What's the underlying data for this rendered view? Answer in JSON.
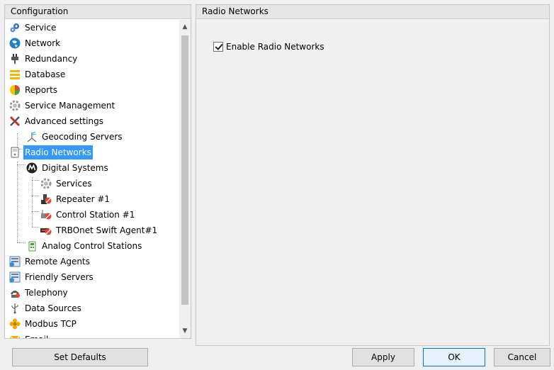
{
  "left_panel": {
    "header": "Configuration",
    "tree": [
      {
        "label": "Service",
        "icon": "gears-icon"
      },
      {
        "label": "Network",
        "icon": "network-globe-icon"
      },
      {
        "label": "Redundancy",
        "icon": "plug-icon"
      },
      {
        "label": "Database",
        "icon": "database-icon"
      },
      {
        "label": "Reports",
        "icon": "reports-icon"
      },
      {
        "label": "Service Management",
        "icon": "gear-icon"
      },
      {
        "label": "Advanced settings",
        "icon": "tools-icon"
      },
      {
        "label": "Geocoding Servers",
        "icon": "geocoding-icon"
      },
      {
        "label": "Radio Networks",
        "icon": "radio-icon",
        "selected": true
      },
      {
        "label": "Digital Systems",
        "icon": "motorola-icon"
      },
      {
        "label": "Services",
        "icon": "gear-icon"
      },
      {
        "label": "Repeater #1",
        "icon": "repeater-disabled-icon"
      },
      {
        "label": "Control Station #1",
        "icon": "control-station-disabled-icon"
      },
      {
        "label": "TRBOnet Swift Agent#1",
        "icon": "swift-agent-disabled-icon"
      },
      {
        "label": "Analog Control Stations",
        "icon": "analog-radio-icon"
      },
      {
        "label": "Remote Agents",
        "icon": "remote-agents-icon"
      },
      {
        "label": "Friendly Servers",
        "icon": "friendly-servers-icon"
      },
      {
        "label": "Telephony",
        "icon": "telephone-icon"
      },
      {
        "label": "Data Sources",
        "icon": "usb-icon"
      },
      {
        "label": "Modbus TCP",
        "icon": "modbus-icon"
      },
      {
        "label": "Email",
        "icon": "email-icon"
      }
    ]
  },
  "right_panel": {
    "header": "Radio Networks",
    "enable_checkbox": {
      "label": "Enable Radio Networks",
      "checked": true
    }
  },
  "buttons": {
    "set_defaults": "Set Defaults",
    "apply": "Apply",
    "ok": "OK",
    "cancel": "Cancel"
  },
  "colors": {
    "selection": "#3399ff",
    "panel_header": "#e6e6e6",
    "window_bg": "#f0f0f0"
  }
}
